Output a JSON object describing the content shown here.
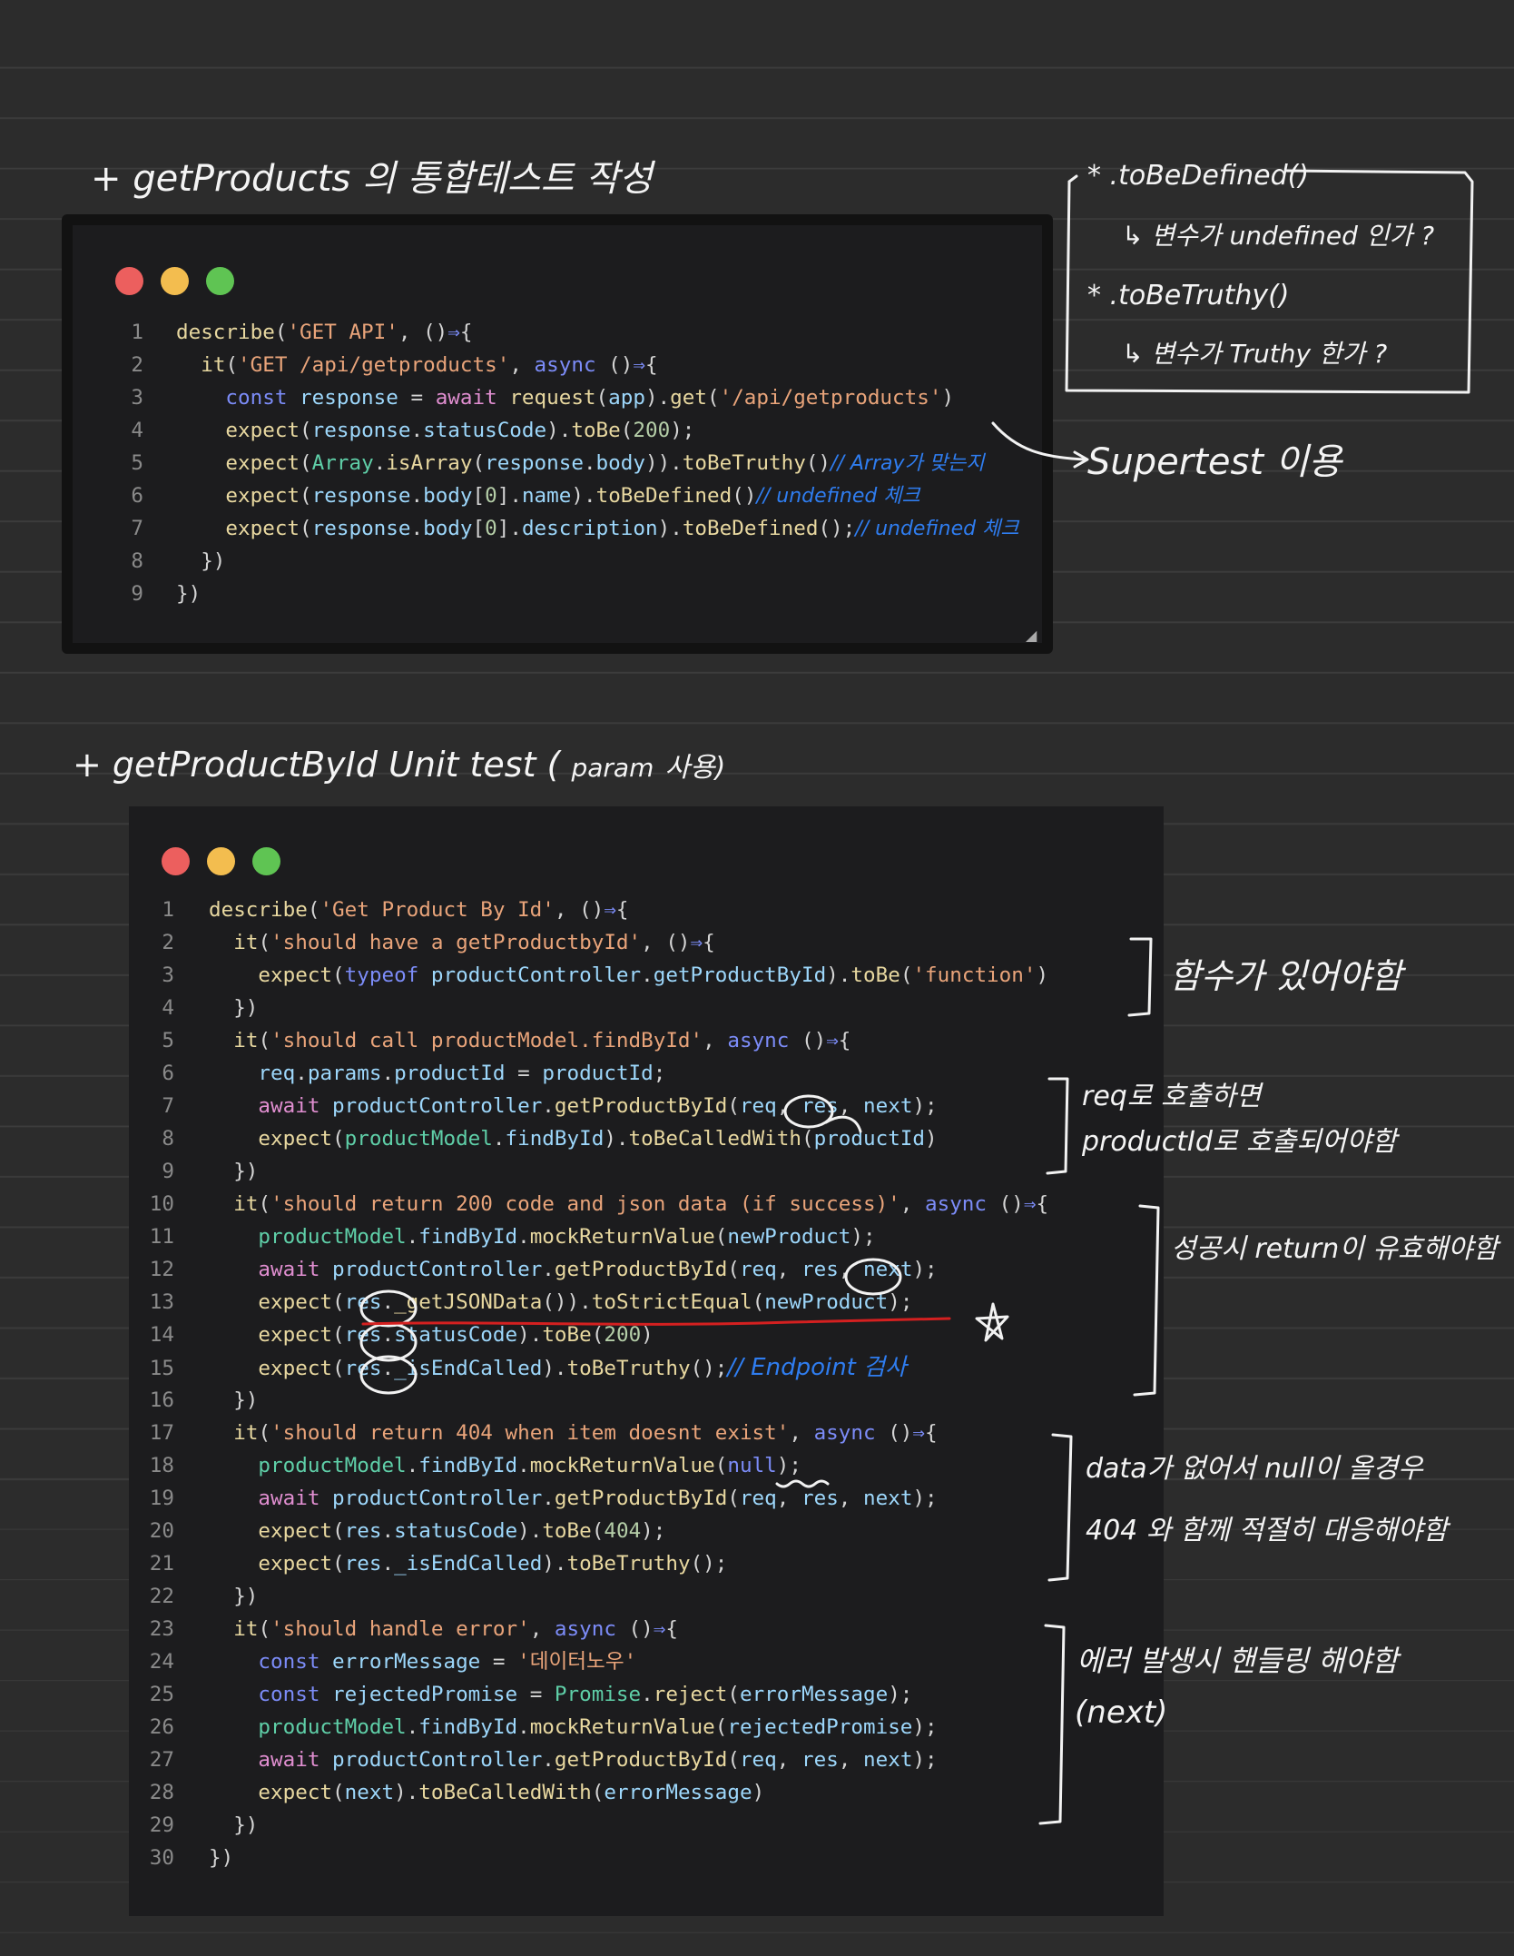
{
  "section1": {
    "heading": "+ getProducts 의 통합테스트 작성",
    "code_lines": [
      "describe('GET API', ()⇒{",
      "  it('GET /api/getproducts', async ()⇒{",
      "    const response = await request(app).get('/api/getproducts')",
      "    expect(response.statusCode).toBe(200);",
      "    expect(Array.isArray(response.body)).toBeTruthy()",
      "    expect(response.body[0].name).toBeDefined()",
      "    expect(response.body[0].description).toBeDefined();",
      "  })",
      "})"
    ],
    "comments": {
      "line5": "// Array가 맞는지",
      "line6": "// undefined 체크",
      "line7": "// undefined 체크"
    },
    "box": {
      "item1_title": "* .toBeDefined()",
      "item1_desc": "↳ 변수가 undefined 인가 ?",
      "item2_title": "* .toBeTruthy()",
      "item2_desc": "↳ 변수가 Truthy 한가 ?"
    },
    "supertest_note": "Supertest 이용"
  },
  "section2": {
    "heading_main": "+ getProductById Unit test (",
    "heading_param": "param",
    "heading_end": "사용)",
    "code_lines": [
      "describe('Get Product By Id', ()⇒{",
      "  it('should have a getProductbyId', ()⇒{",
      "    expect(typeof productController.getProductById).toBe('function')",
      "  })",
      "  it('should call productModel.findById', async ()⇒{",
      "    req.params.productId = productId;",
      "    await productController.getProductById(req, res, next);",
      "    expect(productModel.findById).toBeCalledWith(productId)",
      "  })",
      "  it('should return 200 code and json data (if success)', async ()⇒{",
      "    productModel.findById.mockReturnValue(newProduct);",
      "    await productController.getProductById(req, res, next);",
      "    expect(res._getJSONData()).toStrictEqual(newProduct);",
      "    expect(res.statusCode).toBe(200)",
      "    expect(res._isEndCalled).toBeTruthy();",
      "  })",
      "  it('should return 404 when item doesnt exist', async ()⇒{",
      "    productModel.findById.mockReturnValue(null);",
      "    await productController.getProductById(req, res, next);",
      "    expect(res.statusCode).toBe(404);",
      "    expect(res._isEndCalled).toBeTruthy();",
      "  })",
      "  it('should handle error', async ()⇒{",
      "    const errorMessage = '데이터노우'",
      "    const rejectedPromise = Promise.reject(errorMessage);",
      "    productModel.findById.mockReturnValue(rejectedPromise);",
      "    await productController.getProductById(req, res, next);",
      "    expect(next).toBeCalledWith(errorMessage)",
      "  })",
      "})"
    ],
    "comment_line15": "// Endpoint 검사",
    "notes": {
      "n1": "함수가 있어야함",
      "n2a": "req로 호출하면",
      "n2b": "productId로 호출되어야함",
      "n3": "성공시 return이 유효해야함",
      "n4a": "data가 없어서 null이 올경우",
      "n4b": "404 와 함께 적절히 대응해야함",
      "n5a": "에러 발생시 핸들링 해야함",
      "n5b": "(next)"
    }
  },
  "colors": {
    "background": "#2c2c2c",
    "editor": "#1c1c1e",
    "dot_red": "#ec5f5e",
    "dot_yellow": "#f3bd4f",
    "dot_green": "#5fc453",
    "annotation_blue": "#2f7df0",
    "underline_red": "#d42020"
  }
}
